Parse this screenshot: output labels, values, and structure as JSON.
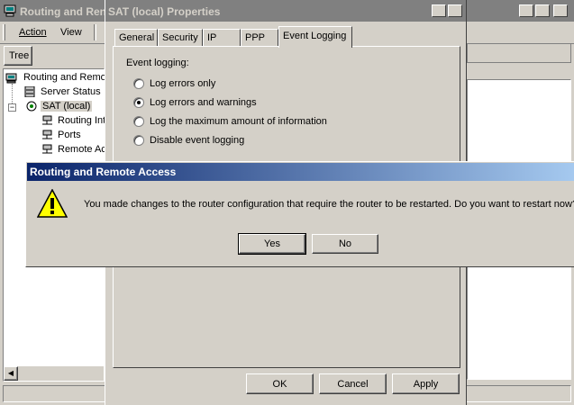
{
  "main_window": {
    "title": "Routing and Remote Access",
    "title_visible": "Routing and Ren",
    "menu": {
      "action": "Action",
      "view": "View"
    },
    "tree_tab": "Tree",
    "caption_buttons": {
      "minimize": "_",
      "maximize": "□",
      "close": "✕"
    },
    "tree": [
      {
        "label": "Routing and Remote Access",
        "visible": "Routing and Remo"
      },
      {
        "label": "Server Status"
      },
      {
        "label": "SAT (local)"
      },
      {
        "label": "Routing Interfaces",
        "visible": "Routing Int"
      },
      {
        "label": "Ports"
      },
      {
        "label": "Remote Access",
        "visible": "Remote Ac"
      }
    ]
  },
  "properties_dialog": {
    "title": "SAT (local) Properties",
    "help_btn": "?",
    "close_btn": "✕",
    "tabs": [
      "General",
      "Security",
      "IP",
      "PPP",
      "Event Logging"
    ],
    "active_tab": "Event Logging",
    "section_label": "Event logging:",
    "options": [
      {
        "label": "Log errors only",
        "selected": false
      },
      {
        "label": "Log errors and warnings",
        "selected": true
      },
      {
        "label": "Log the maximum amount of information",
        "selected": false
      },
      {
        "label": "Disable event logging",
        "selected": false
      }
    ],
    "buttons": {
      "ok": "OK",
      "cancel": "Cancel",
      "apply": "Apply"
    }
  },
  "message_box": {
    "title": "Routing and Remote Access",
    "message": "You made changes to the router configuration that require the router to be restarted. Do you want to restart now?",
    "buttons": {
      "yes": "Yes",
      "no": "No"
    },
    "icon": "warning-icon"
  },
  "colors": {
    "active_title_start": "#0a246a",
    "active_title_end": "#a6caf0",
    "inactive_title": "#808080",
    "face": "#d4d0c8"
  }
}
